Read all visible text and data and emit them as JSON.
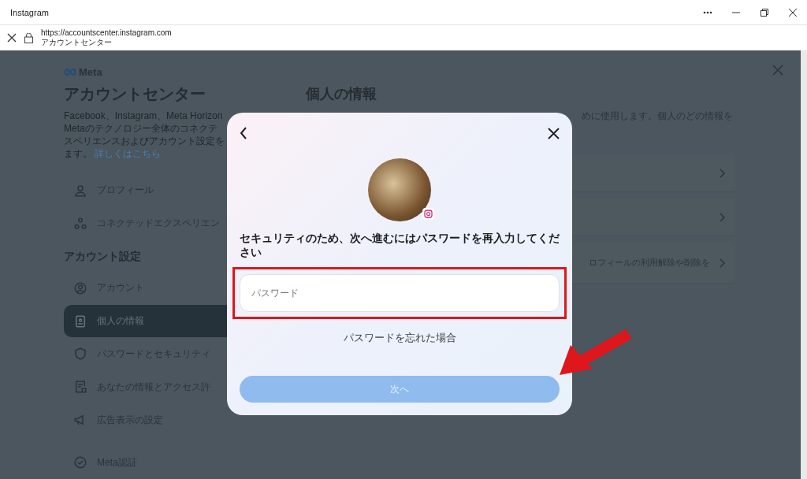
{
  "window": {
    "title": "Instagram"
  },
  "address_bar": {
    "url": "https://accountscenter.instagram.com",
    "page_title": "アカウントセンター"
  },
  "sidebar": {
    "brand": "Meta",
    "heading": "アカウントセンター",
    "description_lines": [
      "Facebook、Instagram、Meta Horizon",
      "Metaのテクノロジー全体のコネクテ",
      "スペリエンスおよびアカウント設定を"
    ],
    "description_end": "ます。",
    "link": "詳しくはこちら",
    "items": [
      {
        "kind": "person",
        "label": "プロフィール",
        "selected": false
      },
      {
        "kind": "connected",
        "label": "コネクテッドエクスペリエン",
        "selected": false
      }
    ],
    "section": "アカウント設定",
    "settings_items": [
      {
        "kind": "account",
        "label": "アカウント",
        "selected": false
      },
      {
        "kind": "id",
        "label": "個人の情報",
        "selected": true
      },
      {
        "kind": "shield",
        "label": "パスワードとセキュリティ",
        "selected": false
      },
      {
        "kind": "doc",
        "label": "あなたの情報とアクセス許",
        "selected": false
      },
      {
        "kind": "megaphone",
        "label": "広告表示の設定",
        "selected": false
      }
    ],
    "footer_item": {
      "kind": "badge",
      "label": "Meta認証",
      "selected": false
    }
  },
  "main": {
    "heading": "個人の情報",
    "description": "めに使用します。個人のどの情報を",
    "rows": [
      {
        "kind": "blank"
      },
      {
        "kind": "blank"
      },
      {
        "kind": "text",
        "text": "ロフィールの利用解除や削除を"
      }
    ]
  },
  "dialog": {
    "prompt": "セキュリティのため、次へ進むにはパスワードを再入力してください",
    "password": {
      "placeholder": "パスワード",
      "highlighted": true
    },
    "forgot_link": "パスワードを忘れた場合",
    "next_button": {
      "label": "次へ",
      "disabled": true
    },
    "pointer_arrow": true
  }
}
